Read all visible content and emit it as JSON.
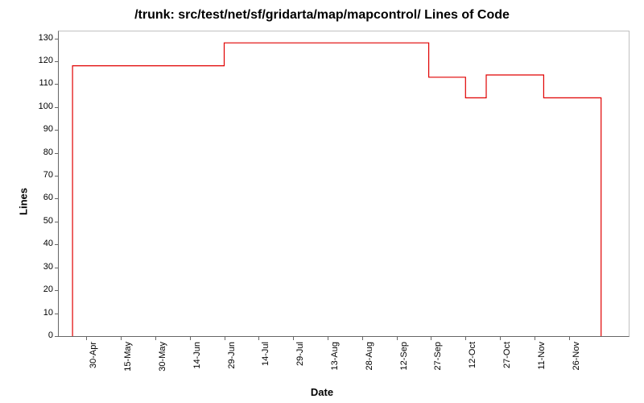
{
  "chart_data": {
    "type": "line",
    "title": "/trunk: src/test/net/sf/gridarta/map/mapcontrol/ Lines of Code",
    "xlabel": "Date",
    "ylabel": "Lines",
    "ylim": [
      0,
      133
    ],
    "y_ticks": [
      0,
      10,
      20,
      30,
      40,
      50,
      60,
      70,
      80,
      90,
      100,
      110,
      120,
      130
    ],
    "x_ticks": [
      "30-Apr",
      "15-May",
      "30-May",
      "14-Jun",
      "29-Jun",
      "14-Jul",
      "29-Jul",
      "13-Aug",
      "28-Aug",
      "12-Sep",
      "27-Sep",
      "12-Oct",
      "27-Oct",
      "11-Nov",
      "26-Nov"
    ],
    "x_range_days": 248,
    "x_start": "18-Apr",
    "series": [
      {
        "name": "Lines of Code",
        "color": "#e00000",
        "points": [
          {
            "x_day": 0,
            "y": 0
          },
          {
            "x_day": 0,
            "y": 118
          },
          {
            "x_day": 66,
            "y": 118
          },
          {
            "x_day": 66,
            "y": 128
          },
          {
            "x_day": 155,
            "y": 128
          },
          {
            "x_day": 155,
            "y": 113
          },
          {
            "x_day": 171,
            "y": 113
          },
          {
            "x_day": 171,
            "y": 104
          },
          {
            "x_day": 180,
            "y": 104
          },
          {
            "x_day": 180,
            "y": 114
          },
          {
            "x_day": 205,
            "y": 114
          },
          {
            "x_day": 205,
            "y": 104
          },
          {
            "x_day": 230,
            "y": 104
          },
          {
            "x_day": 230,
            "y": 0
          }
        ]
      }
    ]
  }
}
